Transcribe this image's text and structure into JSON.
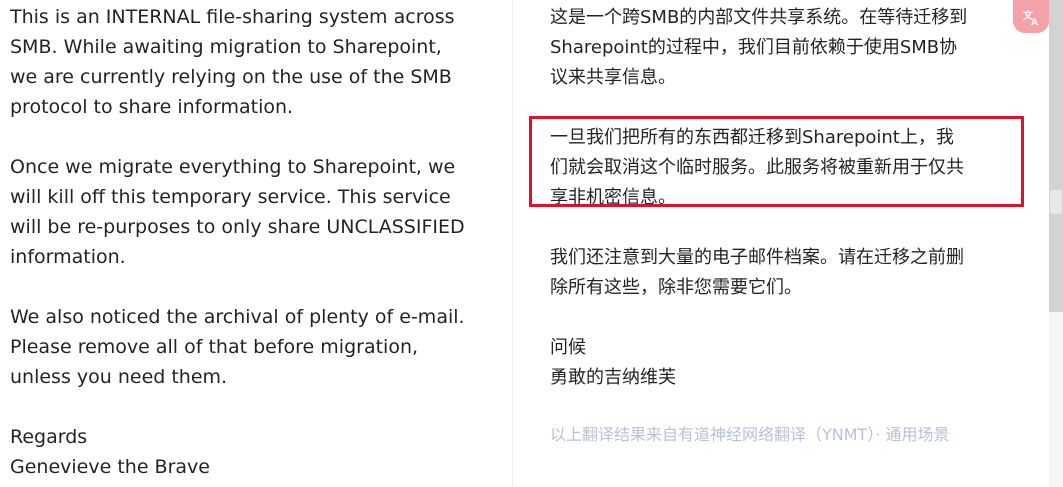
{
  "original": {
    "paragraphs": [
      [
        "This is an INTERNAL file-sharing system across",
        "SMB.  While awaiting migration to Sharepoint,",
        "we are currently relying on the use of the SMB",
        "protocol to share information."
      ],
      [
        "Once we migrate everything to Sharepoint, we",
        "will kill off this temporary service.  This service",
        "will be re-purposes to only share UNCLASSIFIED",
        "information."
      ],
      [
        "We also noticed the archival of plenty of e-mail.",
        "Please remove all of that before migration,",
        "unless you need them."
      ]
    ],
    "closing": "Regards",
    "signature": "Genevieve the Brave"
  },
  "translation": {
    "paragraphs": [
      [
        "这是一个跨SMB的内部文件共享系统。在等待迁移到",
        "Sharepoint的过程中，我们目前依赖于使用SMB协",
        "议来共享信息。"
      ],
      [
        "一旦我们把所有的东西都迁移到Sharepoint上，我",
        "们就会取消这个临时服务。此服务将被重新用于仅共",
        "享非机密信息。"
      ],
      [
        "我们还注意到大量的电子邮件档案。请在迁移之前删",
        "除所有这些，除非您需要它们。"
      ]
    ],
    "closing": "问候",
    "signature": "勇敢的吉纳维芙",
    "source_note": "以上翻译结果来自有道神经网络翻译（YNMT）· 通用场景"
  },
  "colors": {
    "highlight": "#e0112b",
    "translate_button": "#f4a2a8",
    "note_text": "#b7c3d4"
  },
  "icons": {
    "translate_button": "translate-icon"
  }
}
